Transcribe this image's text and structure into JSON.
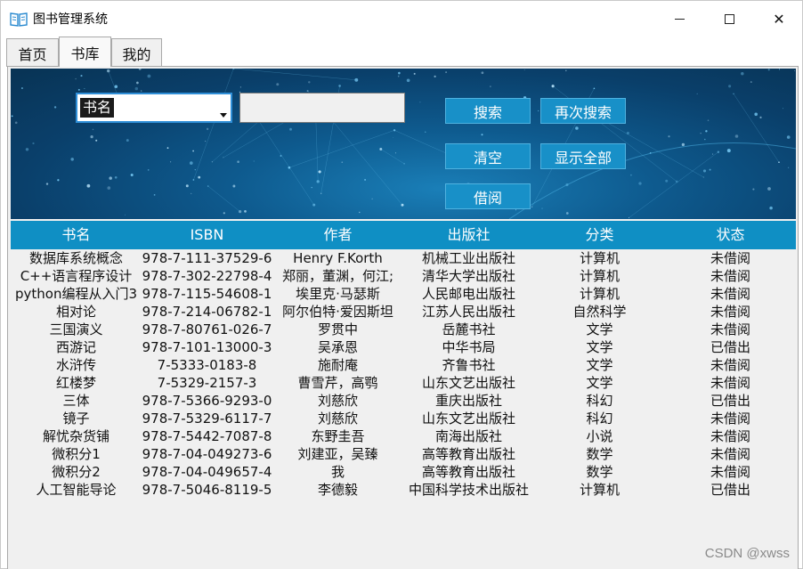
{
  "window": {
    "title": "图书管理系统",
    "icon": "open-book-icon",
    "controls": {
      "minimize": "minimize-icon",
      "maximize": "maximize-icon",
      "close": "✕"
    }
  },
  "tabs": [
    {
      "label": "首页",
      "active": false
    },
    {
      "label": "书库",
      "active": true
    },
    {
      "label": "我的",
      "active": false
    }
  ],
  "search": {
    "field_select": "书名",
    "query_value": ""
  },
  "buttons": {
    "search": "搜索",
    "search_again": "再次搜索",
    "clear": "清空",
    "show_all": "显示全部",
    "borrow": "借阅"
  },
  "table": {
    "columns": [
      "书名",
      "ISBN",
      "作者",
      "出版社",
      "分类",
      "状态"
    ],
    "rows": [
      [
        "数据库系统概念",
        "978-7-111-37529-6",
        "Henry F.Korth",
        "机械工业出版社",
        "计算机",
        "未借阅"
      ],
      [
        "C++语言程序设计",
        "978-7-302-22798-4",
        "郑丽，董渊，何江;",
        "清华大学出版社",
        "计算机",
        "未借阅"
      ],
      [
        "python编程从入门3",
        "978-7-115-54608-1",
        "埃里克·马瑟斯",
        "人民邮电出版社",
        "计算机",
        "未借阅"
      ],
      [
        "相对论",
        "978-7-214-06782-1",
        "阿尔伯特·爱因斯坦",
        "江苏人民出版社",
        "自然科学",
        "未借阅"
      ],
      [
        "三国演义",
        "978-7-80761-026-7",
        "罗贯中",
        "岳麓书社",
        "文学",
        "未借阅"
      ],
      [
        "西游记",
        "978-7-101-13000-3",
        "吴承恩",
        "中华书局",
        "文学",
        "已借出"
      ],
      [
        "水浒传",
        "7-5333-0183-8",
        "施耐庵",
        "齐鲁书社",
        "文学",
        "未借阅"
      ],
      [
        "红楼梦",
        "7-5329-2157-3",
        "曹雪芹，高鹗",
        "山东文艺出版社",
        "文学",
        "未借阅"
      ],
      [
        "三体",
        "978-7-5366-9293-0",
        "刘慈欣",
        "重庆出版社",
        "科幻",
        "已借出"
      ],
      [
        "镜子",
        "978-7-5329-6117-7",
        "刘慈欣",
        "山东文艺出版社",
        "科幻",
        "未借阅"
      ],
      [
        "解忧杂货铺",
        "978-7-5442-7087-8",
        "东野圭吾",
        "南海出版社",
        "小说",
        "未借阅"
      ],
      [
        "微积分1",
        "978-7-04-049273-6",
        "刘建亚，吴臻",
        "高等教育出版社",
        "数学",
        "未借阅"
      ],
      [
        "微积分2",
        "978-7-04-049657-4",
        "我",
        "高等教育出版社",
        "数学",
        "未借阅"
      ],
      [
        "人工智能导论",
        "978-7-5046-8119-5",
        "李德毅",
        "中国科学技术出版社",
        "计算机",
        "已借出"
      ]
    ]
  },
  "watermark": "CSDN @xwss",
  "colors": {
    "accent": "#0f8fc4",
    "button": "#1890c8",
    "banner_dark": "#083354"
  }
}
